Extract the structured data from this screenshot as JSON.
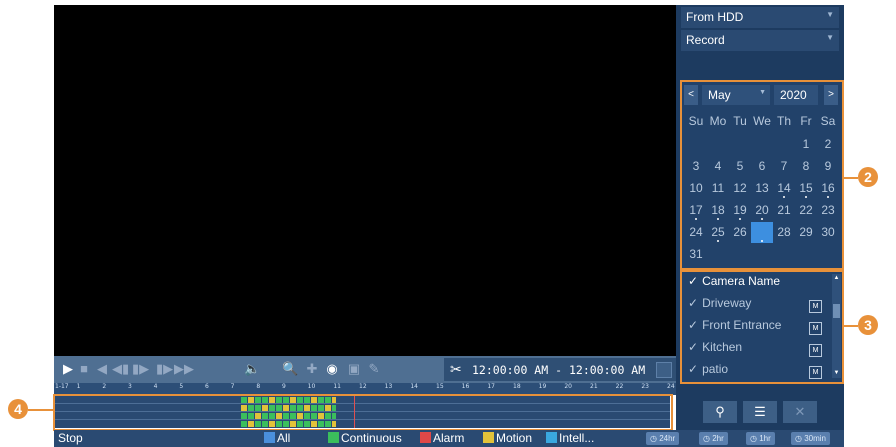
{
  "player": {
    "time_start": "12:00:00 AM",
    "time_sep": "-",
    "time_end": "12:00:00 AM"
  },
  "timeline": {
    "first_label": "1-17",
    "hours": [
      "1",
      "2",
      "3",
      "4",
      "5",
      "6",
      "7",
      "8",
      "9",
      "10",
      "11",
      "12",
      "13",
      "14",
      "15",
      "16",
      "17",
      "18",
      "19",
      "20",
      "21",
      "22",
      "23",
      "24"
    ],
    "cursor_hour": 11.7
  },
  "status": {
    "state": "Stop",
    "legend": [
      {
        "label": "All",
        "color": "#4a8fdc"
      },
      {
        "label": "Continuous",
        "color": "#3bbf5c"
      },
      {
        "label": "Alarm",
        "color": "#e04848"
      },
      {
        "label": "Motion",
        "color": "#e2c23a"
      },
      {
        "label": "Intell...",
        "color": "#3aa8e0"
      }
    ],
    "zoom_buttons": [
      "24hr",
      "2hr",
      "1hr",
      "30min"
    ]
  },
  "panel": {
    "source": "From HDD",
    "mode": "Record"
  },
  "calendar": {
    "prev": "<",
    "next": ">",
    "month": "May",
    "year": "2020",
    "weekdays": [
      "Su",
      "Mo",
      "Tu",
      "We",
      "Th",
      "Fr",
      "Sa"
    ],
    "rows": [
      [
        "",
        "",
        "",
        "",
        "",
        "1",
        "2"
      ],
      [
        "3",
        "4",
        "5",
        "6",
        "7",
        "8",
        "9"
      ],
      [
        "10",
        "11",
        "12",
        "13",
        "14",
        "15",
        "16"
      ],
      [
        "17",
        "18",
        "19",
        "20",
        "21",
        "22",
        "23"
      ],
      [
        "24",
        "25",
        "26",
        "27",
        "28",
        "29",
        "30"
      ],
      [
        "31",
        "",
        "",
        "",
        "",
        "",
        ""
      ]
    ],
    "record_days": [
      "14",
      "15",
      "16",
      "17",
      "18",
      "19",
      "20",
      "25",
      "27"
    ],
    "selected_day": "27"
  },
  "cameras": {
    "header": "Camera Name",
    "items": [
      "Driveway",
      "Front Entrance",
      "Kitchen",
      "patio"
    ],
    "badge": "M"
  },
  "callouts": [
    "2",
    "3",
    "4"
  ],
  "colors": {
    "accent": "#e8913a",
    "continuous": "#3bbf5c",
    "motion": "#e2c23a"
  }
}
